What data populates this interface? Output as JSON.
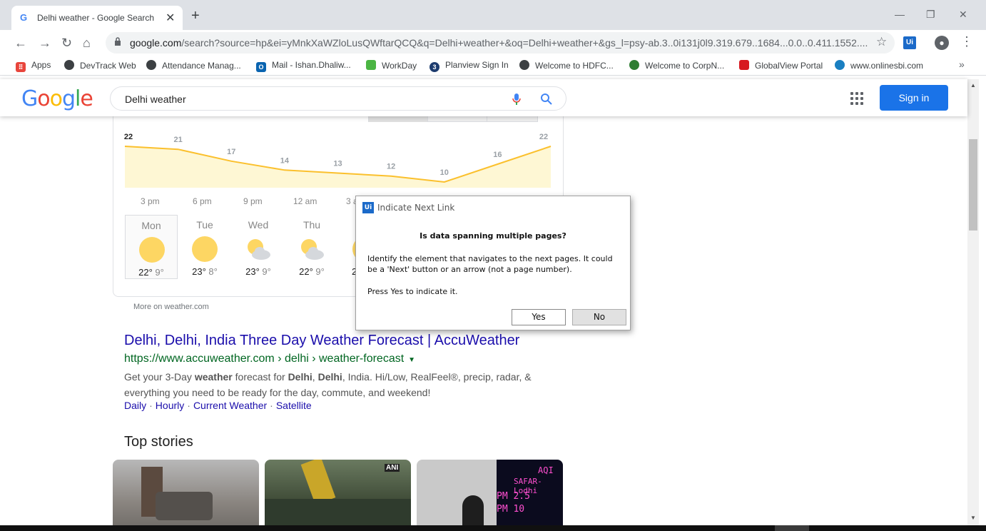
{
  "tab": {
    "title": "Delhi weather - Google Search",
    "favicon": "G"
  },
  "toolbar": {
    "url_domain": "google.com",
    "url_rest": "/search?source=hp&ei=yMnkXaWZloLusQWftarQCQ&q=Delhi+weather+&oq=Delhi+weather+&gs_l=psy-ab.3..0i131j0l9.319.679..1684...0.0..0.411.1552...."
  },
  "bookmarks": [
    {
      "label": "Apps",
      "icon": "apps-grid-icon",
      "color": "#e8453c"
    },
    {
      "label": "DevTrack Web",
      "icon": "globe-icon",
      "color": "#3c4043"
    },
    {
      "label": "Attendance Manag...",
      "icon": "globe-icon",
      "color": "#3c4043"
    },
    {
      "label": "Mail - Ishan.Dhaliw...",
      "icon": "outlook-icon",
      "color": "#0a64b0"
    },
    {
      "label": "WorkDay",
      "icon": "fis-icon",
      "color": "#4bb543"
    },
    {
      "label": "Planview Sign In",
      "icon": "planview-icon",
      "color": "#1d3c6e"
    },
    {
      "label": "Welcome to HDFC...",
      "icon": "globe-icon",
      "color": "#3c4043"
    },
    {
      "label": "Welcome to CorpN...",
      "icon": "corp-icon",
      "color": "#2e7d32"
    },
    {
      "label": "GlobalView Portal",
      "icon": "adp-icon",
      "color": "#d71920"
    },
    {
      "label": "www.onlinesbi.com",
      "icon": "sbi-icon",
      "color": "#1a7fc1"
    }
  ],
  "google": {
    "search_query": "Delhi weather",
    "signin_label": "Sign in"
  },
  "weather": {
    "temps": [
      "22",
      "21",
      "17",
      "14",
      "13",
      "12",
      "10",
      "16",
      "22"
    ],
    "time_labels": [
      "3 pm",
      "6 pm",
      "9 pm",
      "12 am",
      "3 a"
    ],
    "days": [
      {
        "name": "Mon",
        "hi": "22°",
        "lo": "9°",
        "icon": "sun-icon"
      },
      {
        "name": "Tue",
        "hi": "23°",
        "lo": "8°",
        "icon": "sun-icon"
      },
      {
        "name": "Wed",
        "hi": "23°",
        "lo": "9°",
        "icon": "partly-cloudy-icon"
      },
      {
        "name": "Thu",
        "hi": "22°",
        "lo": "9°",
        "icon": "partly-cloudy-icon"
      },
      {
        "name": "",
        "hi": "2",
        "lo": "",
        "icon": "sun-icon"
      }
    ],
    "more_link": "More on weather.com"
  },
  "result": {
    "title": "Delhi, Delhi, India Three Day Weather Forecast | AccuWeather",
    "url": "https://www.accuweather.com › delhi › weather-forecast",
    "snippet_parts": {
      "a": "Get your 3-Day ",
      "b": "weather",
      "c": " forecast for ",
      "d": "Delhi",
      "e": ", ",
      "f": "Delhi",
      "g": ", India. Hi/Low, RealFeel®, precip, radar, &",
      "h": "everything you need to be ready for the day, commute, and weekend!"
    },
    "sitelinks": [
      "Daily",
      "Hourly",
      "Current Weather",
      "Satellite"
    ]
  },
  "top_stories": {
    "heading": "Top stories",
    "ani_badge": "ANI",
    "sign_lines": [
      "AQI",
      "SAFAR-Lodhi",
      "PM 2.5",
      "PM 10"
    ]
  },
  "dialog": {
    "title": "Indicate Next Link",
    "heading": "Is data spanning multiple pages?",
    "body": "Identify the element that navigates to the next pages. It could be a 'Next' button or an arrow (not a page number).",
    "press": "Press Yes to indicate it.",
    "yes": "Yes",
    "no": "No"
  },
  "colors": {
    "chart_line": "#fbc02d",
    "chart_fill": "#fef7d4",
    "google_blue": "#1a73e8",
    "uipath_blue": "#1b6ac9"
  }
}
